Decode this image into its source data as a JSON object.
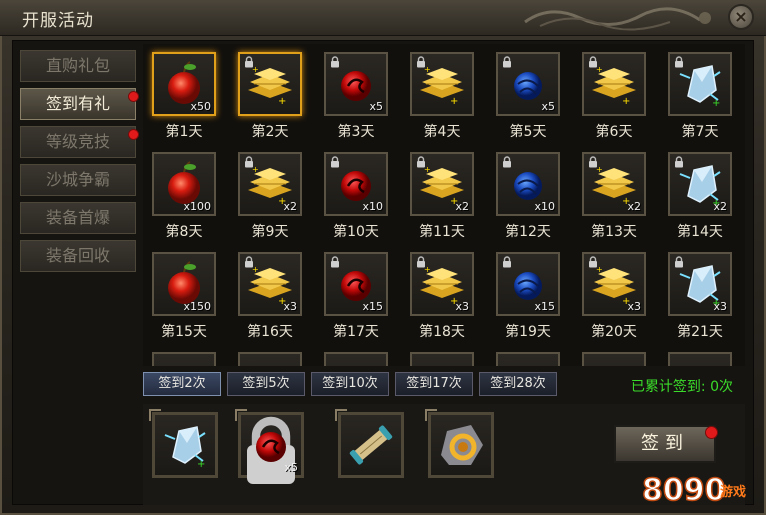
{
  "window": {
    "title": "开服活动",
    "close_glyph": "×"
  },
  "tabs": [
    {
      "label": "直购礼包",
      "active": false,
      "dot": false
    },
    {
      "label": "签到有礼",
      "active": true,
      "dot": true
    },
    {
      "label": "等级竞技",
      "active": false,
      "dot": true
    },
    {
      "label": "沙城争霸",
      "active": false,
      "dot": false
    },
    {
      "label": "装备首爆",
      "active": false,
      "dot": false
    },
    {
      "label": "装备回收",
      "active": false,
      "dot": false
    }
  ],
  "days": [
    {
      "label": "第1天",
      "item": "apple",
      "qty": "x50",
      "highlight": true,
      "lock": false
    },
    {
      "label": "第2天",
      "item": "gold",
      "qty": "",
      "highlight": true,
      "lock": true
    },
    {
      "label": "第3天",
      "item": "redorb",
      "qty": "x5",
      "highlight": false,
      "lock": true
    },
    {
      "label": "第4天",
      "item": "gold",
      "qty": "",
      "highlight": false,
      "lock": true
    },
    {
      "label": "第5天",
      "item": "blueorb",
      "qty": "x5",
      "highlight": false,
      "lock": true
    },
    {
      "label": "第6天",
      "item": "gold",
      "qty": "",
      "highlight": false,
      "lock": true
    },
    {
      "label": "第7天",
      "item": "crystal",
      "qty": "",
      "highlight": false,
      "lock": true
    },
    {
      "label": "第8天",
      "item": "apple",
      "qty": "x100",
      "highlight": false,
      "lock": false
    },
    {
      "label": "第9天",
      "item": "gold",
      "qty": "x2",
      "highlight": false,
      "lock": true
    },
    {
      "label": "第10天",
      "item": "redorb",
      "qty": "x10",
      "highlight": false,
      "lock": true
    },
    {
      "label": "第11天",
      "item": "gold",
      "qty": "x2",
      "highlight": false,
      "lock": true
    },
    {
      "label": "第12天",
      "item": "blueorb",
      "qty": "x10",
      "highlight": false,
      "lock": true
    },
    {
      "label": "第13天",
      "item": "gold",
      "qty": "x2",
      "highlight": false,
      "lock": true
    },
    {
      "label": "第14天",
      "item": "crystal",
      "qty": "x2",
      "highlight": false,
      "lock": true
    },
    {
      "label": "第15天",
      "item": "apple",
      "qty": "x150",
      "highlight": false,
      "lock": false
    },
    {
      "label": "第16天",
      "item": "gold",
      "qty": "x3",
      "highlight": false,
      "lock": true
    },
    {
      "label": "第17天",
      "item": "redorb",
      "qty": "x15",
      "highlight": false,
      "lock": true
    },
    {
      "label": "第18天",
      "item": "gold",
      "qty": "x3",
      "highlight": false,
      "lock": true
    },
    {
      "label": "第19天",
      "item": "blueorb",
      "qty": "x15",
      "highlight": false,
      "lock": true
    },
    {
      "label": "第20天",
      "item": "gold",
      "qty": "x3",
      "highlight": false,
      "lock": true
    },
    {
      "label": "第21天",
      "item": "crystal",
      "qty": "x3",
      "highlight": false,
      "lock": true
    }
  ],
  "milestones": [
    {
      "label": "签到2次",
      "active": true
    },
    {
      "label": "签到5次",
      "active": false
    },
    {
      "label": "签到10次",
      "active": false
    },
    {
      "label": "签到17次",
      "active": false
    },
    {
      "label": "签到28次",
      "active": false
    }
  ],
  "signed_count_text": "已累计签到: 0次",
  "rewards": [
    {
      "item": "crystal",
      "qty": "",
      "lock": false
    },
    {
      "item": "redorb",
      "qty": "x5",
      "lock": true
    },
    {
      "item": "scroll",
      "qty": "",
      "lock": false
    },
    {
      "item": "ring",
      "qty": "",
      "lock": false
    }
  ],
  "sign_button": "签到",
  "watermark": {
    "text": "8090",
    "sub": "游戏"
  },
  "colors": {
    "gold": "#e0a01a",
    "green": "#3adb2a",
    "reddot": "#e01a1a"
  }
}
